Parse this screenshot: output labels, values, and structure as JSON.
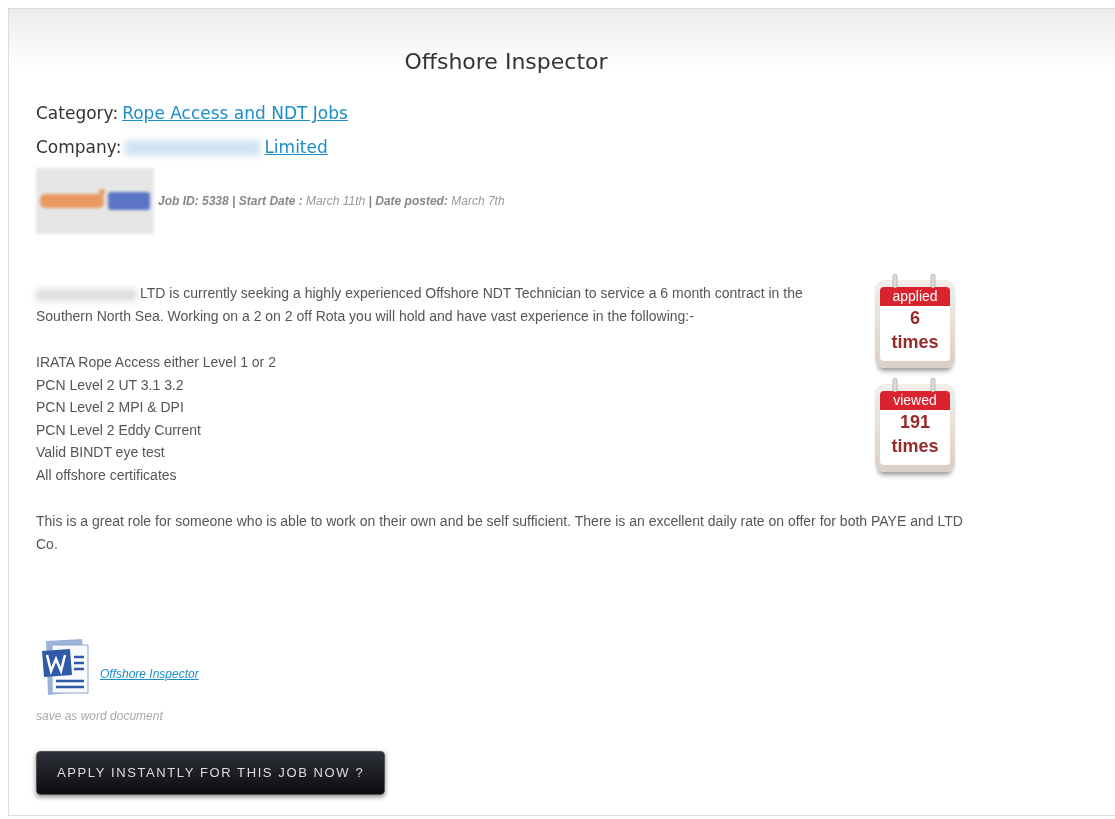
{
  "title": "Offshore Inspector",
  "category": {
    "label": "Category:",
    "link": "Rope Access and NDT Jobs"
  },
  "company": {
    "label": "Company:",
    "link": "Limited"
  },
  "meta": "**Job ID: 5338 | Start Date :** March 11th **| Date posted:** March 7th",
  "description": {
    "intro": "LTD is currently seeking a highly experienced Offshore NDT Technician to service a 6 month contract in the Southern North Sea. Working on a 2 on 2 off Rota you will hold and have vast experience in the following:-",
    "requirements": [
      "IRATA Rope Access either Level 1 or 2",
      "PCN Level 2 UT 3.1 3.2",
      "PCN Level 2 MPI & DPI",
      "PCN Level 2 Eddy Current",
      "Valid BINDT eye test",
      "All offshore certificates"
    ],
    "closing": "This is a great role for someone who is able to work on their own and be self sufficient. There is an excellent daily rate on offer for both PAYE and LTD Co."
  },
  "stats": [
    {
      "label": "applied",
      "count": "6",
      "unit": "times"
    },
    {
      "label": "viewed",
      "count": "191",
      "unit": "times"
    }
  ],
  "attachment": {
    "link": "Offshore Inspector",
    "caption": "save as word document"
  },
  "apply_button": "APPLY INSTANTLY FOR THIS JOB NOW ?"
}
